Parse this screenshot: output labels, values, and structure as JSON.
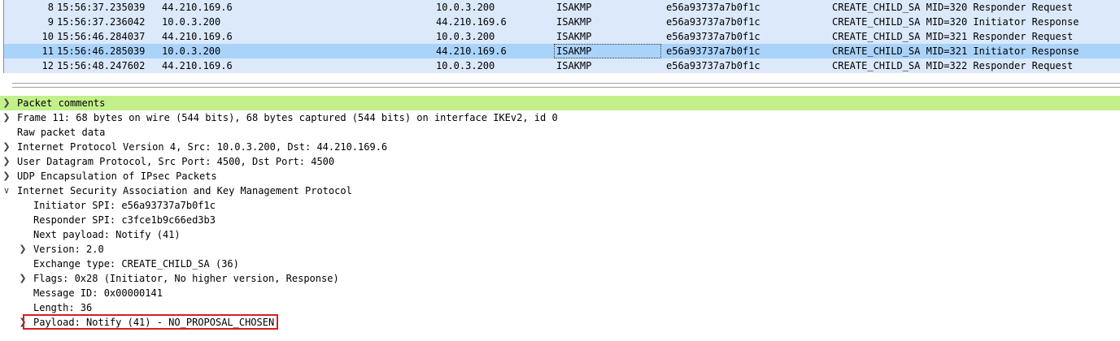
{
  "packet_list": {
    "rows": [
      {
        "no": "8",
        "time": "15:56:37.235039",
        "src": "44.210.169.6",
        "dst": "10.0.3.200",
        "proto": "ISAKMP",
        "spi": "e56a93737a7b0f1c",
        "info": "CREATE_CHILD_SA MID=320 Responder Request",
        "selected": false
      },
      {
        "no": "9",
        "time": "15:56:37.236042",
        "src": "10.0.3.200",
        "dst": "44.210.169.6",
        "proto": "ISAKMP",
        "spi": "e56a93737a7b0f1c",
        "info": "CREATE_CHILD_SA MID=320 Initiator Response",
        "selected": false
      },
      {
        "no": "10",
        "time": "15:56:46.284037",
        "src": "44.210.169.6",
        "dst": "10.0.3.200",
        "proto": "ISAKMP",
        "spi": "e56a93737a7b0f1c",
        "info": "CREATE_CHILD_SA MID=321 Responder Request",
        "selected": false
      },
      {
        "no": "11",
        "time": "15:56:46.285039",
        "src": "10.0.3.200",
        "dst": "44.210.169.6",
        "proto": "ISAKMP",
        "spi": "e56a93737a7b0f1c",
        "info": "CREATE_CHILD_SA MID=321 Initiator Response",
        "selected": true
      },
      {
        "no": "12",
        "time": "15:56:48.247602",
        "src": "44.210.169.6",
        "dst": "10.0.3.200",
        "proto": "ISAKMP",
        "spi": "e56a93737a7b0f1c",
        "info": "CREATE_CHILD_SA MID=322 Responder Request",
        "selected": false
      }
    ]
  },
  "details": {
    "nodes": [
      {
        "text": "Packet comments",
        "level": 0,
        "expander": "collapsed",
        "highlight": true
      },
      {
        "text": "Frame 11: 68 bytes on wire (544 bits), 68 bytes captured (544 bits) on interface IKEv2, id 0",
        "level": 0,
        "expander": "collapsed"
      },
      {
        "text": "Raw packet data",
        "level": 0,
        "expander": "none"
      },
      {
        "text": "Internet Protocol Version 4, Src: 10.0.3.200, Dst: 44.210.169.6",
        "level": 0,
        "expander": "collapsed"
      },
      {
        "text": "User Datagram Protocol, Src Port: 4500, Dst Port: 4500",
        "level": 0,
        "expander": "collapsed"
      },
      {
        "text": "UDP Encapsulation of IPsec Packets",
        "level": 0,
        "expander": "collapsed"
      },
      {
        "text": "Internet Security Association and Key Management Protocol",
        "level": 0,
        "expander": "expanded"
      },
      {
        "text": "Initiator SPI: e56a93737a7b0f1c",
        "level": 1,
        "expander": "none"
      },
      {
        "text": "Responder SPI: c3fce1b9c66ed3b3",
        "level": 1,
        "expander": "none"
      },
      {
        "text": "Next payload: Notify (41)",
        "level": 1,
        "expander": "none"
      },
      {
        "text": "Version: 2.0",
        "level": 1,
        "expander": "collapsed"
      },
      {
        "text": "Exchange type: CREATE_CHILD_SA (36)",
        "level": 1,
        "expander": "none"
      },
      {
        "text": "Flags: 0x28 (Initiator, No higher version, Response)",
        "level": 1,
        "expander": "collapsed"
      },
      {
        "text": "Message ID: 0x00000141",
        "level": 1,
        "expander": "none"
      },
      {
        "text": "Length: 36",
        "level": 1,
        "expander": "none"
      },
      {
        "text": "Payload: Notify (41) - NO_PROPOSAL_CHOSEN",
        "level": 1,
        "expander": "collapsed",
        "annotated": true
      }
    ]
  },
  "colors": {
    "row_bg": "#dbe9fb",
    "row_selected_bg": "#aad3fa",
    "comment_highlight": "#c3f08a",
    "annotation_border": "#d81e1e"
  },
  "icons": {
    "collapsed": "chevron-right-icon",
    "expanded": "chevron-down-icon"
  }
}
